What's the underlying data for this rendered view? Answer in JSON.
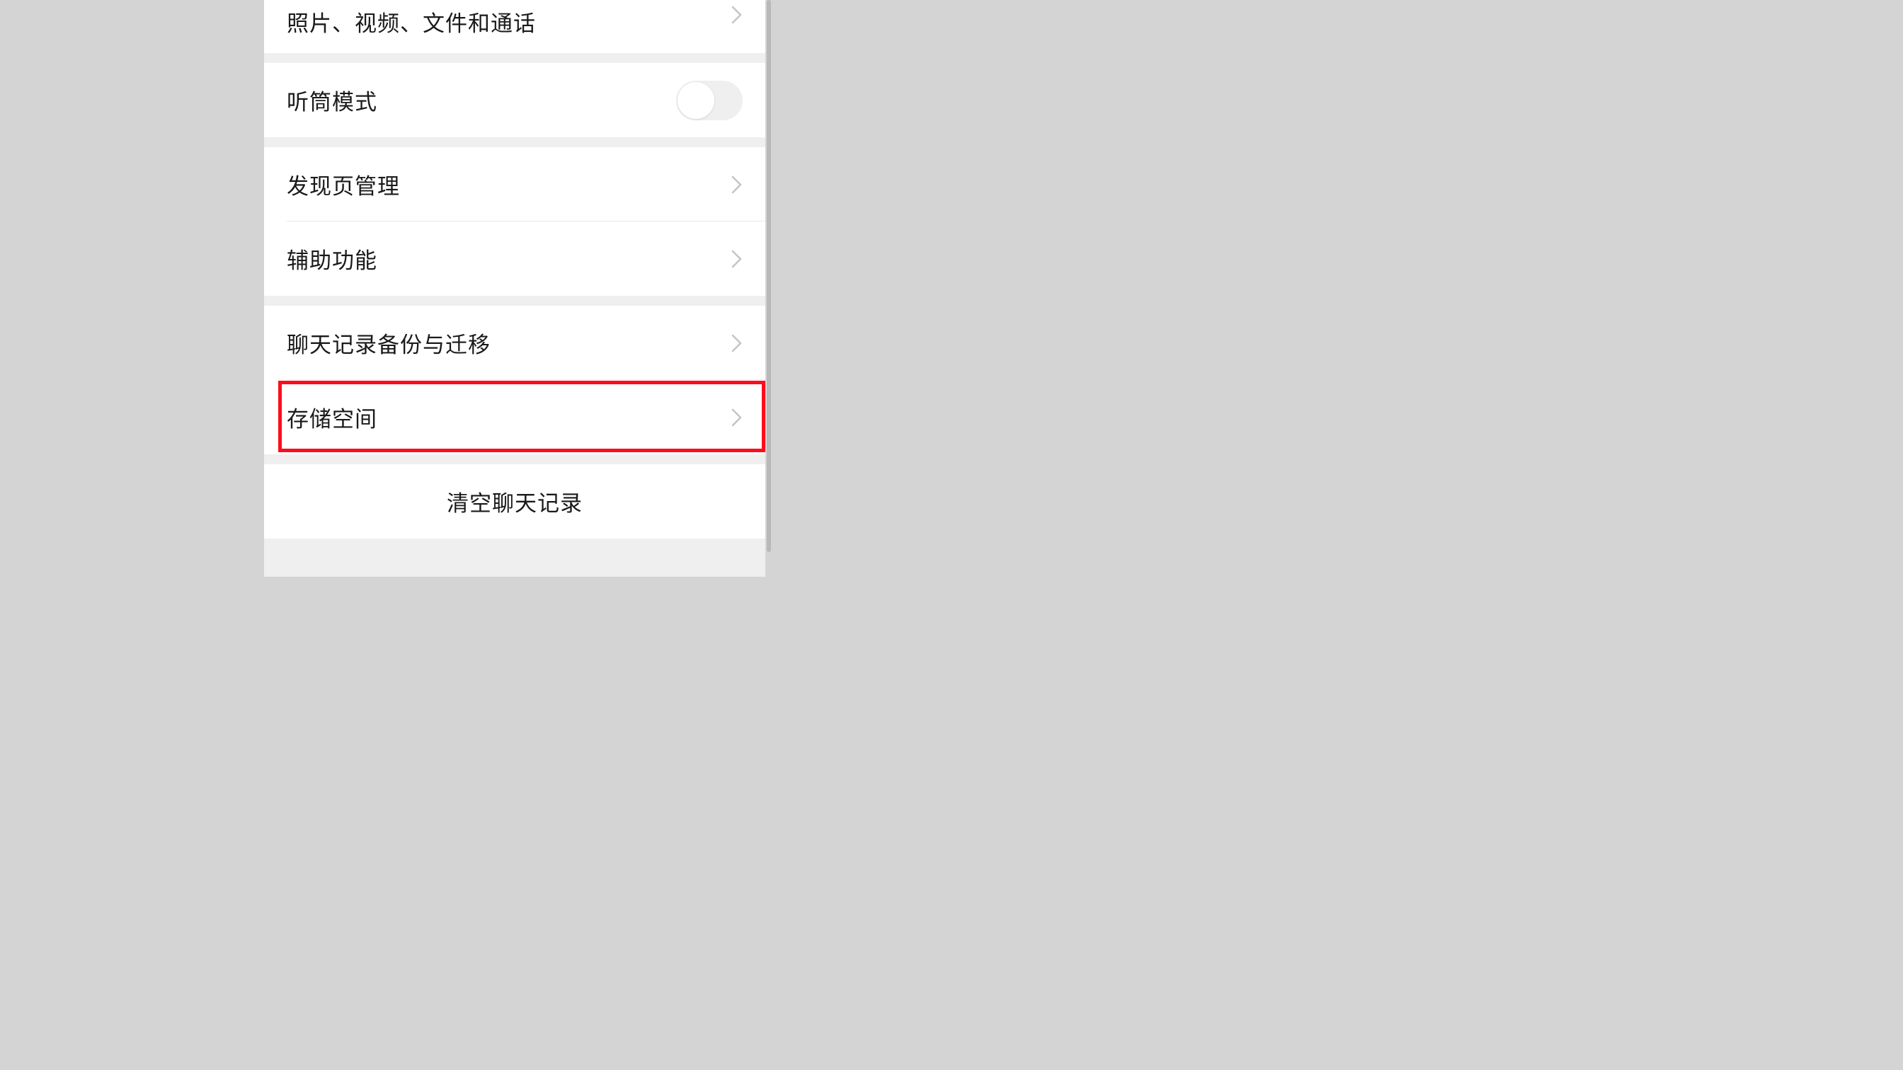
{
  "settings": {
    "groups": [
      {
        "items": [
          {
            "label": "照片、视频、文件和通话",
            "type": "link"
          }
        ]
      },
      {
        "items": [
          {
            "label": "听筒模式",
            "type": "toggle",
            "enabled": false
          }
        ]
      },
      {
        "items": [
          {
            "label": "发现页管理",
            "type": "link"
          },
          {
            "label": "辅助功能",
            "type": "link"
          }
        ]
      },
      {
        "items": [
          {
            "label": "聊天记录备份与迁移",
            "type": "link"
          },
          {
            "label": "存储空间",
            "type": "link",
            "highlighted": true
          }
        ]
      },
      {
        "items": [
          {
            "label": "清空聊天记录",
            "type": "button"
          }
        ]
      }
    ]
  }
}
